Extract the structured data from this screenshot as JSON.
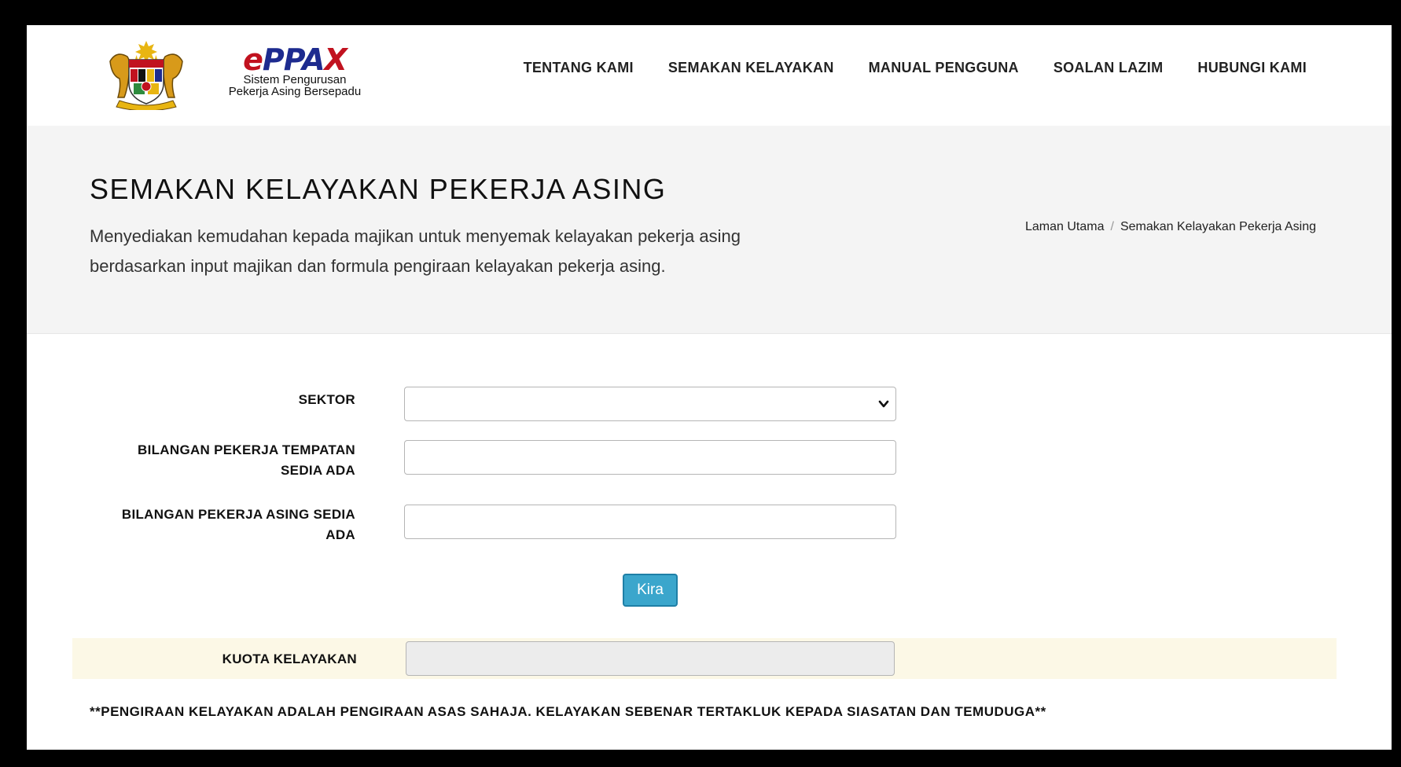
{
  "header": {
    "brand": {
      "mark_e": "e",
      "mark_ppa": "PPA",
      "mark_x": "X",
      "subtitle_line1": "Sistem Pengurusan",
      "subtitle_line2": "Pekerja Asing Bersepadu"
    },
    "nav": [
      {
        "label": "TENTANG KAMI"
      },
      {
        "label": "SEMAKAN KELAYAKAN"
      },
      {
        "label": "MANUAL PENGGUNA"
      },
      {
        "label": "SOALAN LAZIM"
      },
      {
        "label": "HUBUNGI KAMI"
      }
    ]
  },
  "hero": {
    "title": "SEMAKAN KELAYAKAN PEKERJA ASING",
    "description": "Menyediakan kemudahan kepada majikan untuk menyemak kelayakan pekerja asing berdasarkan input majikan dan formula pengiraan kelayakan pekerja asing.",
    "breadcrumb": [
      {
        "label": "Laman Utama"
      },
      {
        "label": "Semakan Kelayakan Pekerja Asing"
      }
    ],
    "breadcrumb_separator": "/"
  },
  "form": {
    "sektor": {
      "label": "SEKTOR",
      "value": ""
    },
    "local_workers": {
      "label_line1": "BILANGAN PEKERJA TEMPATAN",
      "label_line2": "SEDIA ADA",
      "value": ""
    },
    "foreign_workers": {
      "label_line1": "BILANGAN PEKERJA ASING SEDIA",
      "label_line2": "ADA",
      "value": ""
    },
    "submit_label": "Kira",
    "quota": {
      "label": "KUOTA KELAYAKAN",
      "value": ""
    },
    "disclaimer": "**PENGIRAAN KELAYAKAN ADALAH PENGIRAAN ASAS SAHAJA. KELAYAKAN SEBENAR TERTAKLUK KEPADA SIASATAN DAN TEMUDUGA**"
  },
  "colors": {
    "hero_background": "#f4f4f4",
    "button": "#3ba6cc",
    "quota_band": "#fcf8e6"
  }
}
